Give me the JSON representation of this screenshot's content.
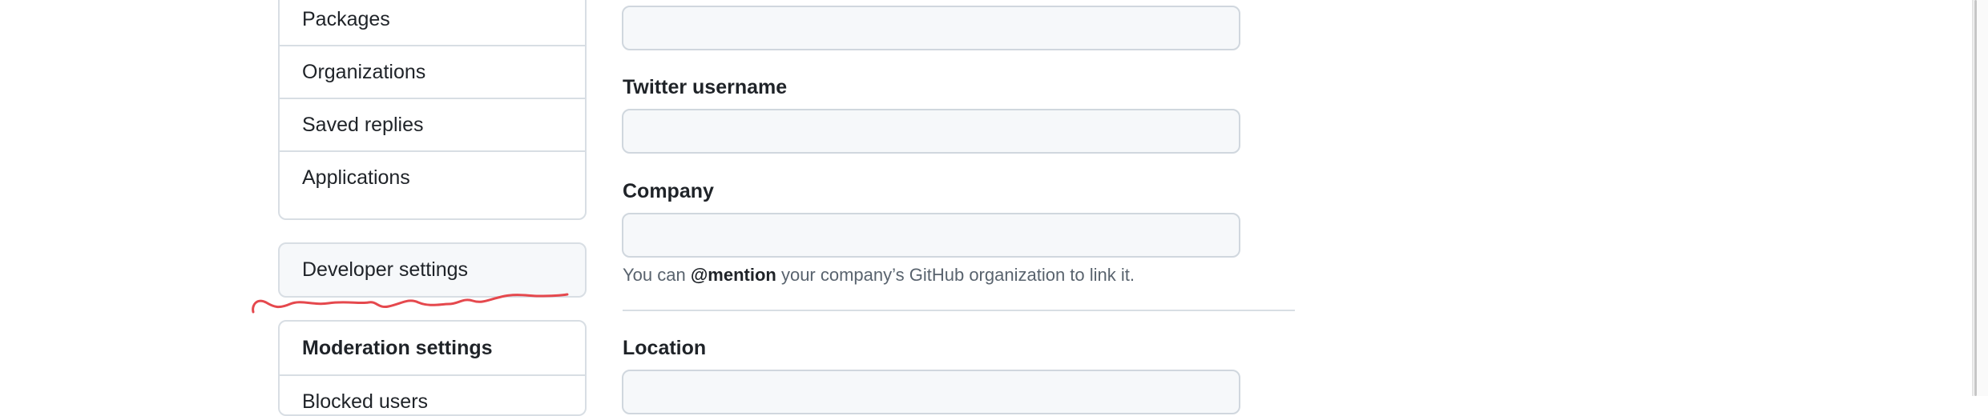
{
  "sidebar": {
    "top_items": [
      "Packages",
      "Organizations",
      "Saved replies",
      "Applications"
    ],
    "developer_settings": "Developer settings",
    "moderation": {
      "heading": "Moderation settings",
      "first_item": "Blocked users"
    }
  },
  "form": {
    "twitter_label": "Twitter username",
    "company_label": "Company",
    "company_note": {
      "prefix": "You can ",
      "mention": "@mention",
      "suffix": " your company’s GitHub organization to link it."
    },
    "location_label": "Location"
  },
  "annotation": {
    "color": "#e5484d"
  },
  "colors": {
    "border": "#d8dee4",
    "input_bg": "#f6f8fa",
    "muted_text": "#59636e"
  }
}
